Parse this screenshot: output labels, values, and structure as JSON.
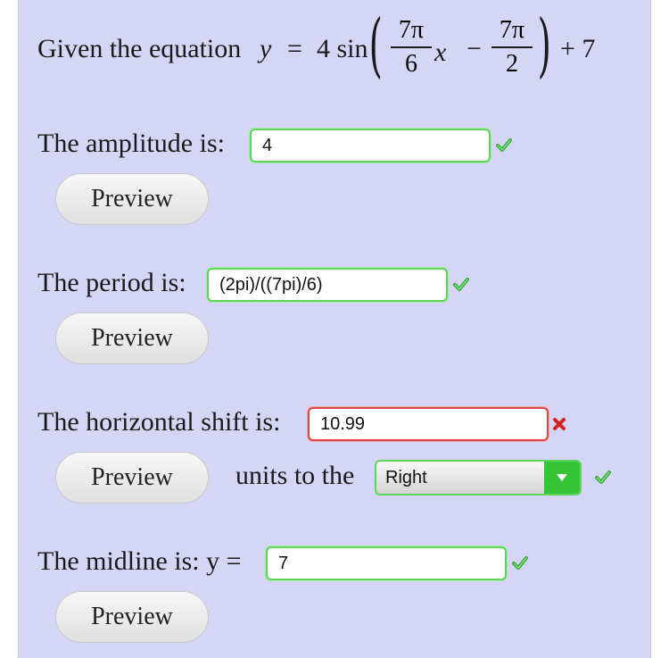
{
  "equation": {
    "prefix": "Given the equation",
    "y": "y",
    "eq": "=",
    "coef": "4 sin",
    "frac1": {
      "num": "7π",
      "den": "6"
    },
    "x": "x",
    "minus": "−",
    "frac2": {
      "num": "7π",
      "den": "2"
    },
    "suffix": "+ 7",
    "paren_left": "(",
    "paren_right": ")"
  },
  "questions": {
    "amplitude": {
      "label": "The amplitude is:",
      "value": "4",
      "status": "correct"
    },
    "period": {
      "label": "The period is:",
      "value": "(2pi)/((7pi)/6)",
      "status": "correct"
    },
    "shift": {
      "label": "The horizontal shift is:",
      "value": "10.99",
      "status": "incorrect",
      "units_label": "units to the",
      "direction": "Right",
      "direction_status": "correct"
    },
    "midline": {
      "label": "The midline is: y =",
      "value": "7",
      "status": "correct"
    }
  },
  "preview_label": "Preview",
  "colors": {
    "panel": "#d5d6f6",
    "correct": "#5ed45e",
    "incorrect": "#e04848",
    "dropdown_arrow": "#35c435"
  }
}
